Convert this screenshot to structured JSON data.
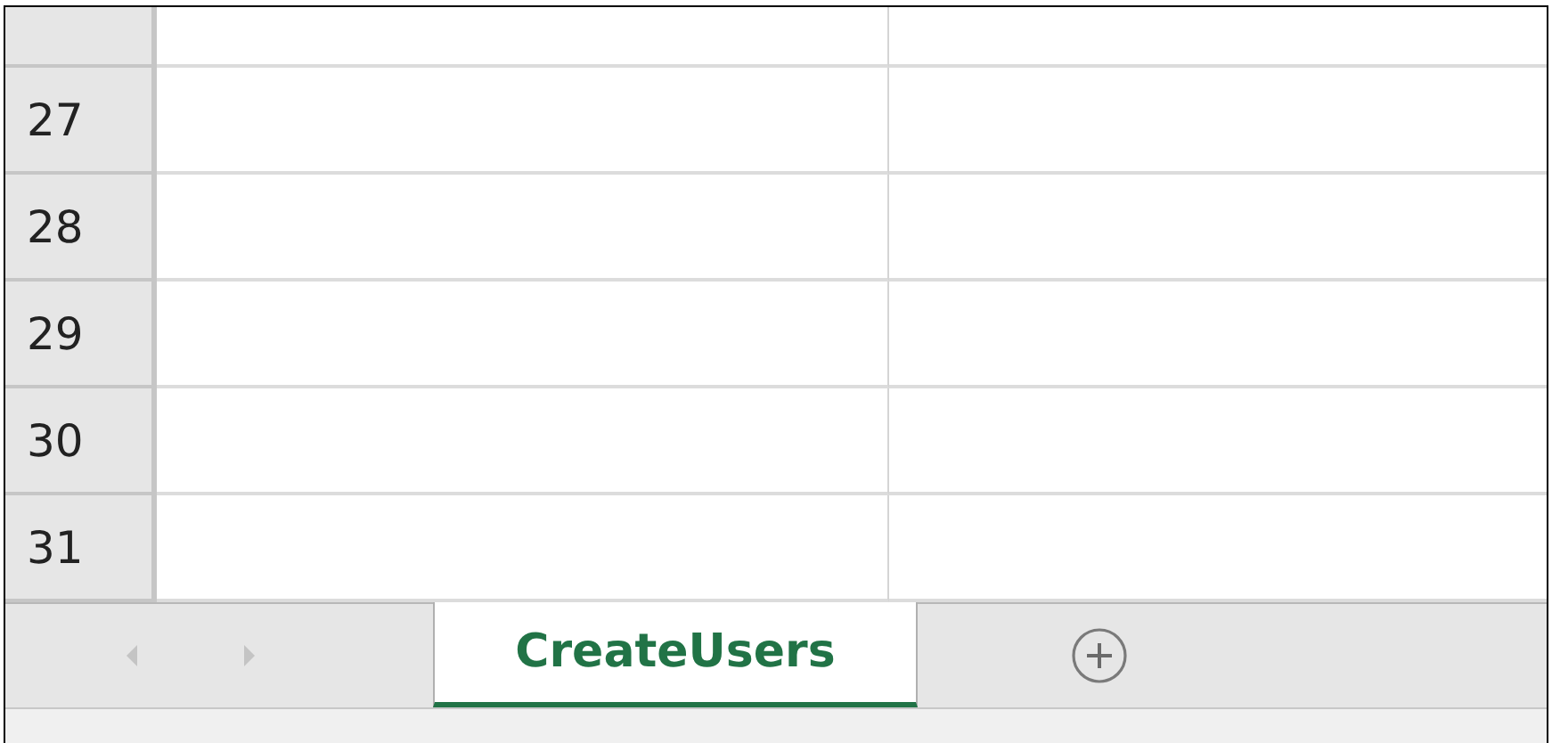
{
  "rows": [
    {
      "number": "27"
    },
    {
      "number": "28"
    },
    {
      "number": "29"
    },
    {
      "number": "30"
    },
    {
      "number": "31"
    }
  ],
  "sheet_nav": {
    "previous_disabled": true,
    "next_disabled": true
  },
  "sheet_tabs": [
    {
      "label": "CreateUsers",
      "selected": true
    }
  ]
}
